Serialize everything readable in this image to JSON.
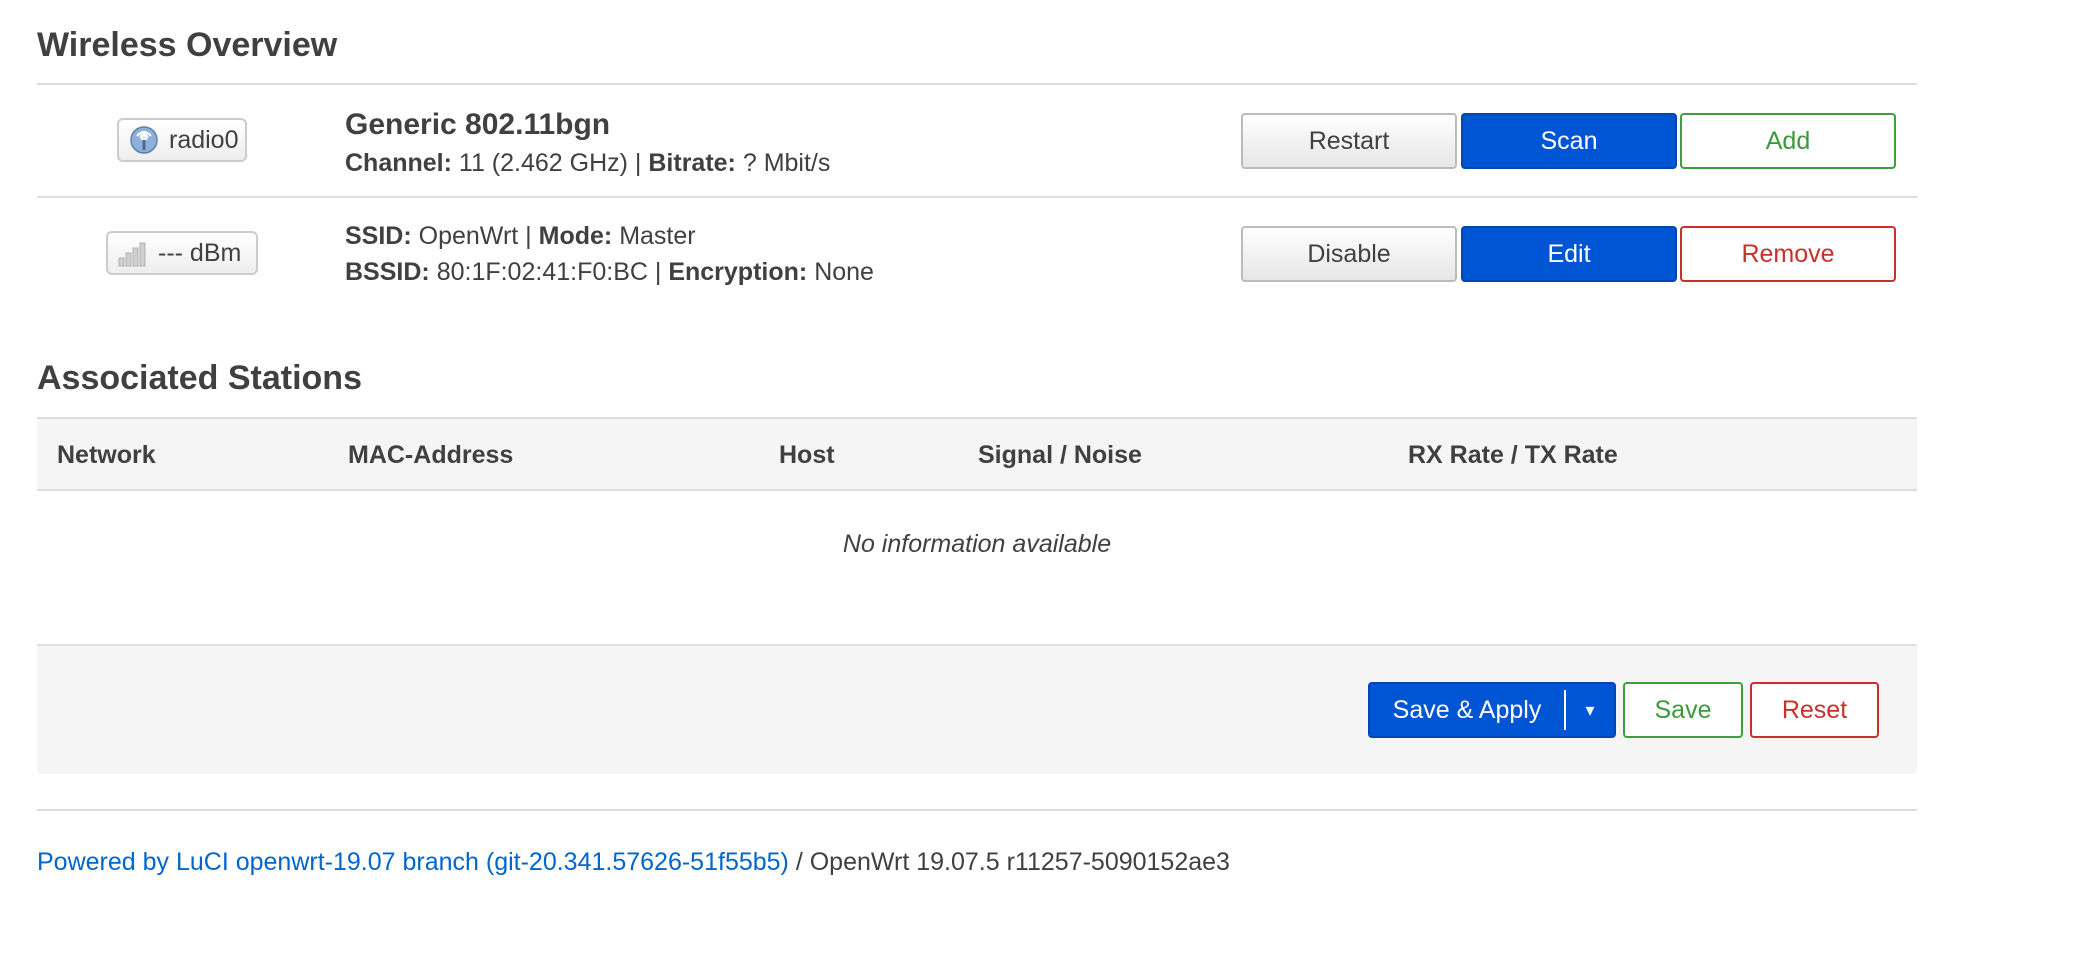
{
  "wireless_overview": {
    "title": "Wireless Overview",
    "radio": {
      "badge_label": "radio0",
      "badge_icon": "wifi-radio-icon",
      "name": "Generic 802.11bgn",
      "channel_label": "Channel:",
      "channel_value": "11 (2.462 GHz)",
      "separator": "|",
      "bitrate_label": "Bitrate:",
      "bitrate_value": "? Mbit/s",
      "buttons": {
        "restart": "Restart",
        "scan": "Scan",
        "add": "Add"
      }
    },
    "network": {
      "badge_label": "--- dBm",
      "badge_icon": "signal-strength-icon",
      "ssid_label": "SSID:",
      "ssid_value": "OpenWrt",
      "mode_label": "Mode:",
      "mode_value": "Master",
      "bssid_label": "BSSID:",
      "bssid_value": "80:1F:02:41:F0:BC",
      "encryption_label": "Encryption:",
      "encryption_value": "None",
      "separator": "|",
      "buttons": {
        "disable": "Disable",
        "edit": "Edit",
        "remove": "Remove"
      }
    }
  },
  "associated_stations": {
    "title": "Associated Stations",
    "columns": [
      "Network",
      "MAC-Address",
      "Host",
      "Signal / Noise",
      "RX Rate / TX Rate"
    ],
    "empty_message": "No information available"
  },
  "actions": {
    "save_apply": "Save & Apply",
    "dropdown_glyph": "▾",
    "save": "Save",
    "reset": "Reset"
  },
  "footer": {
    "link_text": "Powered by LuCI openwrt-19.07 branch (git-20.341.57626-51f55b5)",
    "version_text": " / OpenWrt 19.07.5 r11257-5090152ae3"
  },
  "colors": {
    "primary": "#0055d4",
    "positive": "#3a9a3a",
    "negative": "#c9302c",
    "link": "#0066cc"
  }
}
